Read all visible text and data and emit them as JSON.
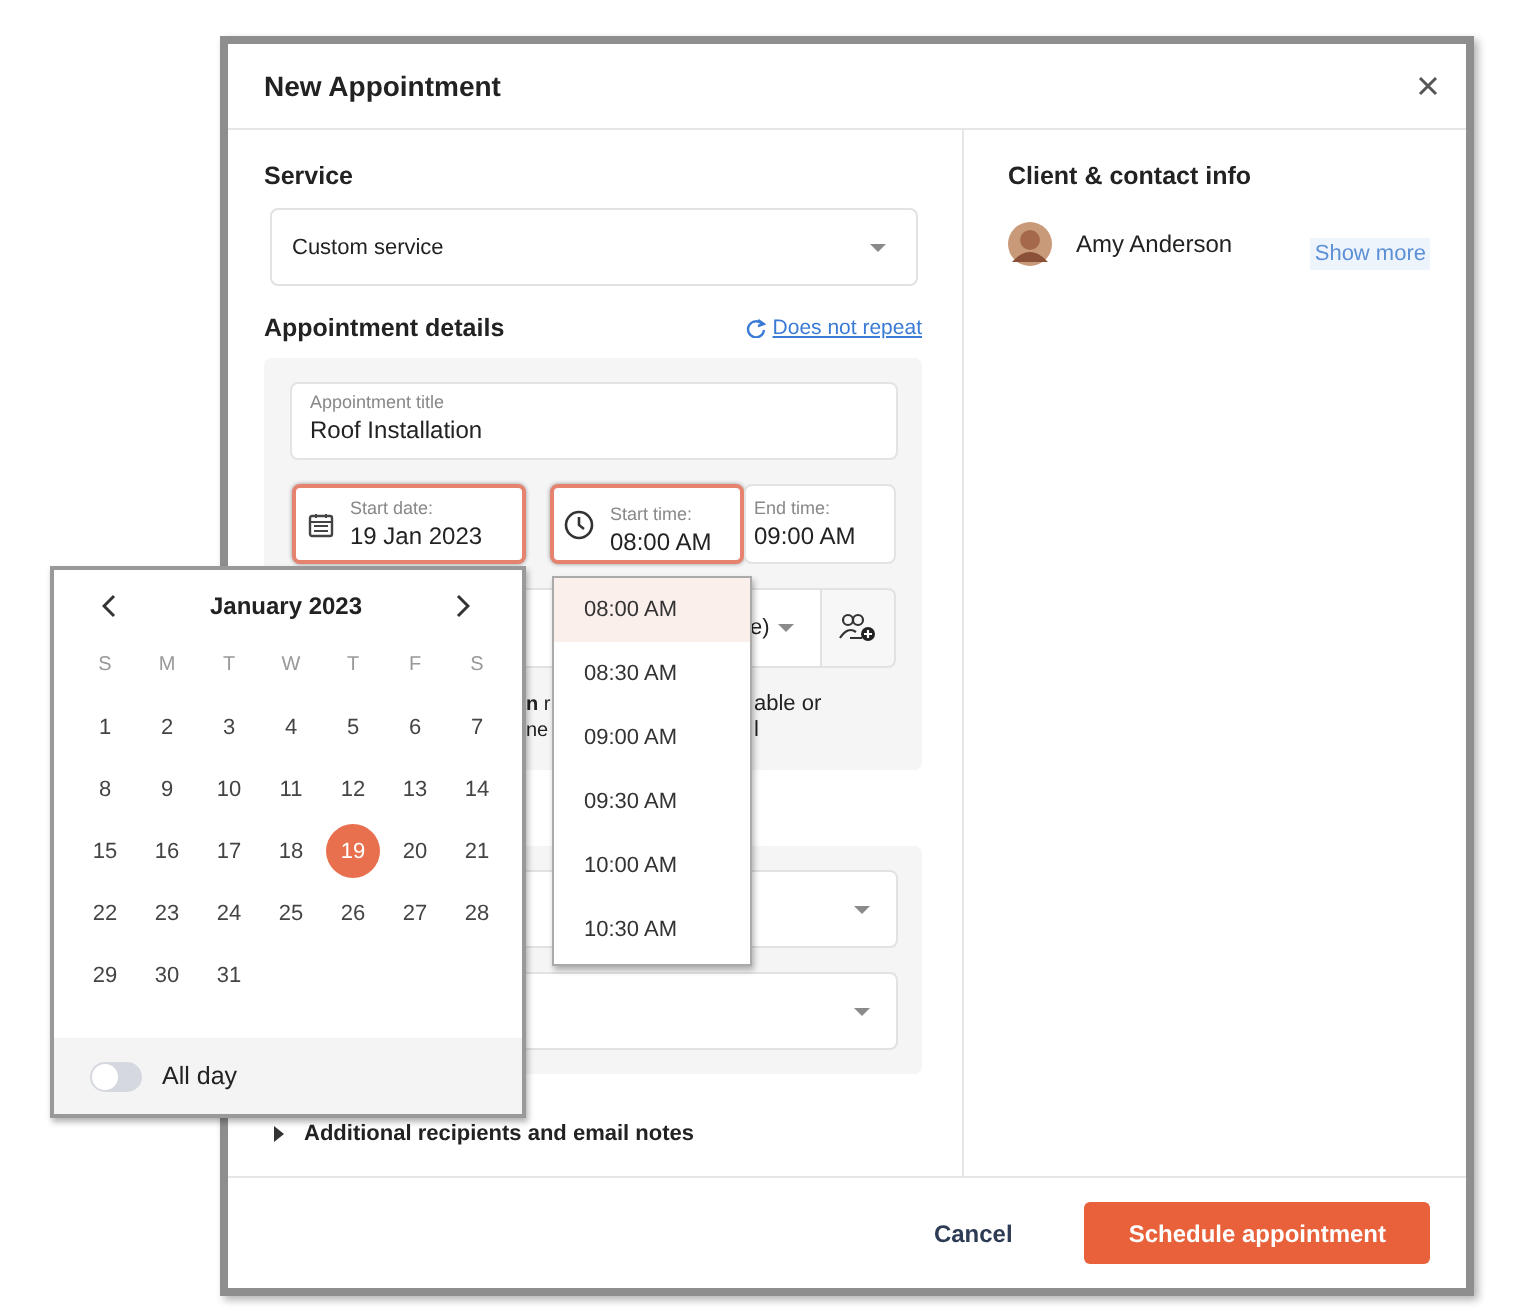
{
  "dialog": {
    "title": "New Appointment"
  },
  "service": {
    "label": "Service",
    "value": "Custom service"
  },
  "details": {
    "heading": "Appointment details",
    "repeat_link": "Does not repeat",
    "title_field": {
      "label": "Appointment title",
      "value": "Roof Installation"
    },
    "date_fields": [
      {
        "kind": "date",
        "label": "Start date:",
        "value": "19 Jan 2023",
        "focused": true
      },
      {
        "kind": "time",
        "label": "Start time:",
        "value": "08:00 AM",
        "focused": true
      },
      {
        "kind": "plain",
        "label": "End time:",
        "value": "09:00 AM",
        "focused": false
      }
    ],
    "team_select": {
      "value": "e)"
    },
    "note_lines": [
      {
        "left": "**n** r",
        "right": "able or"
      },
      {
        "left": "ne",
        "right": "l"
      }
    ]
  },
  "additional": {
    "label": "Additional recipients and email notes",
    "expanded": false
  },
  "client": {
    "heading": "Client & contact info",
    "name": "Amy Anderson",
    "show_more": "Show more"
  },
  "footer": {
    "cancel": "Cancel",
    "submit": "Schedule appointment"
  },
  "calendar": {
    "month": "January 2023",
    "weekdays": [
      "S",
      "M",
      "T",
      "W",
      "T",
      "F",
      "S"
    ],
    "days": [
      {
        "label": "1",
        "selected": false
      },
      {
        "label": "2",
        "selected": false
      },
      {
        "label": "3",
        "selected": false
      },
      {
        "label": "4",
        "selected": false
      },
      {
        "label": "5",
        "selected": false
      },
      {
        "label": "6",
        "selected": false
      },
      {
        "label": "7",
        "selected": false
      },
      {
        "label": "8",
        "selected": false
      },
      {
        "label": "9",
        "selected": false
      },
      {
        "label": "10",
        "selected": false
      },
      {
        "label": "11",
        "selected": false
      },
      {
        "label": "12",
        "selected": false
      },
      {
        "label": "13",
        "selected": false
      },
      {
        "label": "14",
        "selected": false
      },
      {
        "label": "15",
        "selected": false
      },
      {
        "label": "16",
        "selected": false
      },
      {
        "label": "17",
        "selected": false
      },
      {
        "label": "18",
        "selected": false
      },
      {
        "label": "19",
        "selected": true
      },
      {
        "label": "20",
        "selected": false
      },
      {
        "label": "21",
        "selected": false
      },
      {
        "label": "22",
        "selected": false
      },
      {
        "label": "23",
        "selected": false
      },
      {
        "label": "24",
        "selected": false
      },
      {
        "label": "25",
        "selected": false
      },
      {
        "label": "26",
        "selected": false
      },
      {
        "label": "27",
        "selected": false
      },
      {
        "label": "28",
        "selected": false
      },
      {
        "label": "29",
        "selected": false
      },
      {
        "label": "30",
        "selected": false
      },
      {
        "label": "31",
        "selected": false
      }
    ],
    "all_day": {
      "label": "All day",
      "on": false
    }
  },
  "time_options": [
    {
      "label": "08:00 AM",
      "selected": true
    },
    {
      "label": "08:30 AM",
      "selected": false
    },
    {
      "label": "09:00 AM",
      "selected": false
    },
    {
      "label": "09:30 AM",
      "selected": false
    },
    {
      "label": "10:00 AM",
      "selected": false
    },
    {
      "label": "10:30 AM",
      "selected": false
    }
  ]
}
